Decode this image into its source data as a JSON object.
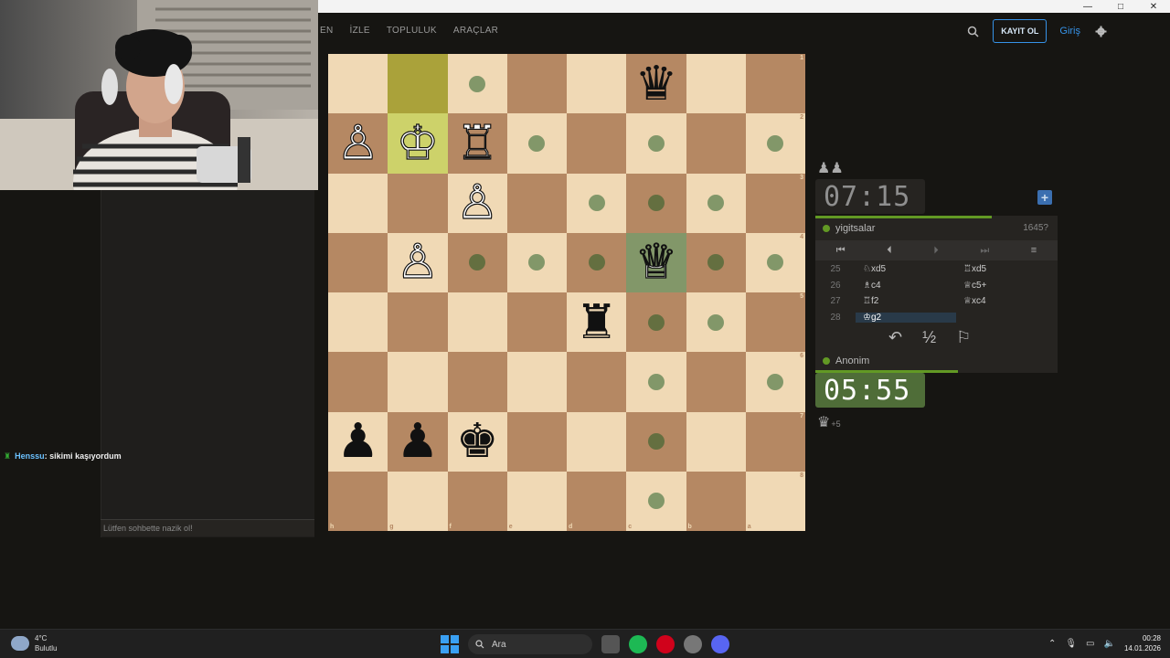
{
  "window": {
    "controls": [
      "—",
      "□",
      "✕"
    ]
  },
  "nav": {
    "links": [
      "EN",
      "İZLE",
      "TOPLULUK",
      "ARAÇLAR"
    ],
    "register_label": "KAYIT OL",
    "login_label": "Giriş",
    "icons": [
      "search-icon",
      "gear-icon"
    ]
  },
  "chat": {
    "message": {
      "flair": "♜",
      "user": "Henssu",
      "text": ": sikimi kaşıyordum"
    },
    "placeholder": "Lütfen sohbette nazik ol!"
  },
  "board": {
    "orientation": "black",
    "rank_labels": [
      "1",
      "2",
      "3",
      "4",
      "5",
      "6",
      "7",
      "8"
    ],
    "file_labels": [
      "h",
      "g",
      "f",
      "e",
      "d",
      "c",
      "b",
      "a"
    ],
    "pieces": [
      {
        "square": "c1",
        "piece": "♛",
        "color": "b"
      },
      {
        "square": "h2",
        "piece": "♙",
        "color": "w"
      },
      {
        "square": "g2",
        "piece": "♔",
        "color": "w"
      },
      {
        "square": "f2",
        "piece": "♖",
        "color": "w"
      },
      {
        "square": "f3",
        "piece": "♙",
        "color": "w"
      },
      {
        "square": "g4",
        "piece": "♙",
        "color": "w"
      },
      {
        "square": "c4",
        "piece": "♕",
        "color": "w"
      },
      {
        "square": "d5",
        "piece": "♜",
        "color": "b"
      },
      {
        "square": "h7",
        "piece": "♟",
        "color": "b"
      },
      {
        "square": "g7",
        "piece": "♟",
        "color": "b"
      },
      {
        "square": "f7",
        "piece": "♚",
        "color": "b"
      }
    ],
    "last_move": [
      "g1",
      "g2"
    ],
    "selected": "c4",
    "dots": [
      "f1",
      "e2",
      "c2",
      "a2",
      "d3",
      "c3",
      "b3",
      "f4",
      "e4",
      "d4",
      "b4",
      "a4",
      "c5",
      "b5",
      "c6",
      "a6",
      "c7",
      "c8"
    ]
  },
  "opponent": {
    "captured": "♟♟",
    "clock": "07:15",
    "name": "yigitsalar",
    "rating": "1645?",
    "clock_fraction": 0.73
  },
  "player": {
    "captured": "♛",
    "advantage": "+5",
    "clock": "05:55",
    "name": "Anonim",
    "clock_fraction": 0.59
  },
  "controls": {
    "icons": [
      "first-icon",
      "prev-icon",
      "next-icon",
      "last-icon",
      "menu-icon"
    ],
    "glyphs": [
      "⏮",
      "⏴",
      "⏵",
      "⏭",
      "≡"
    ]
  },
  "moves": [
    {
      "no": "25",
      "white": "♘xd5",
      "black": "♖xd5"
    },
    {
      "no": "26",
      "white": "♗c4",
      "black": "♕c5+"
    },
    {
      "no": "27",
      "white": "♖f2",
      "black": "♕xc4"
    },
    {
      "no": "28",
      "white": "♔g2",
      "black": ""
    }
  ],
  "actions": {
    "takeback": "↶",
    "draw": "½",
    "resign": "⚐"
  },
  "taskbar": {
    "weather_temp": "4°C",
    "weather_desc": "Bulutlu",
    "search_label": "Ara",
    "time": "00:28",
    "date": "14.01.2026"
  }
}
